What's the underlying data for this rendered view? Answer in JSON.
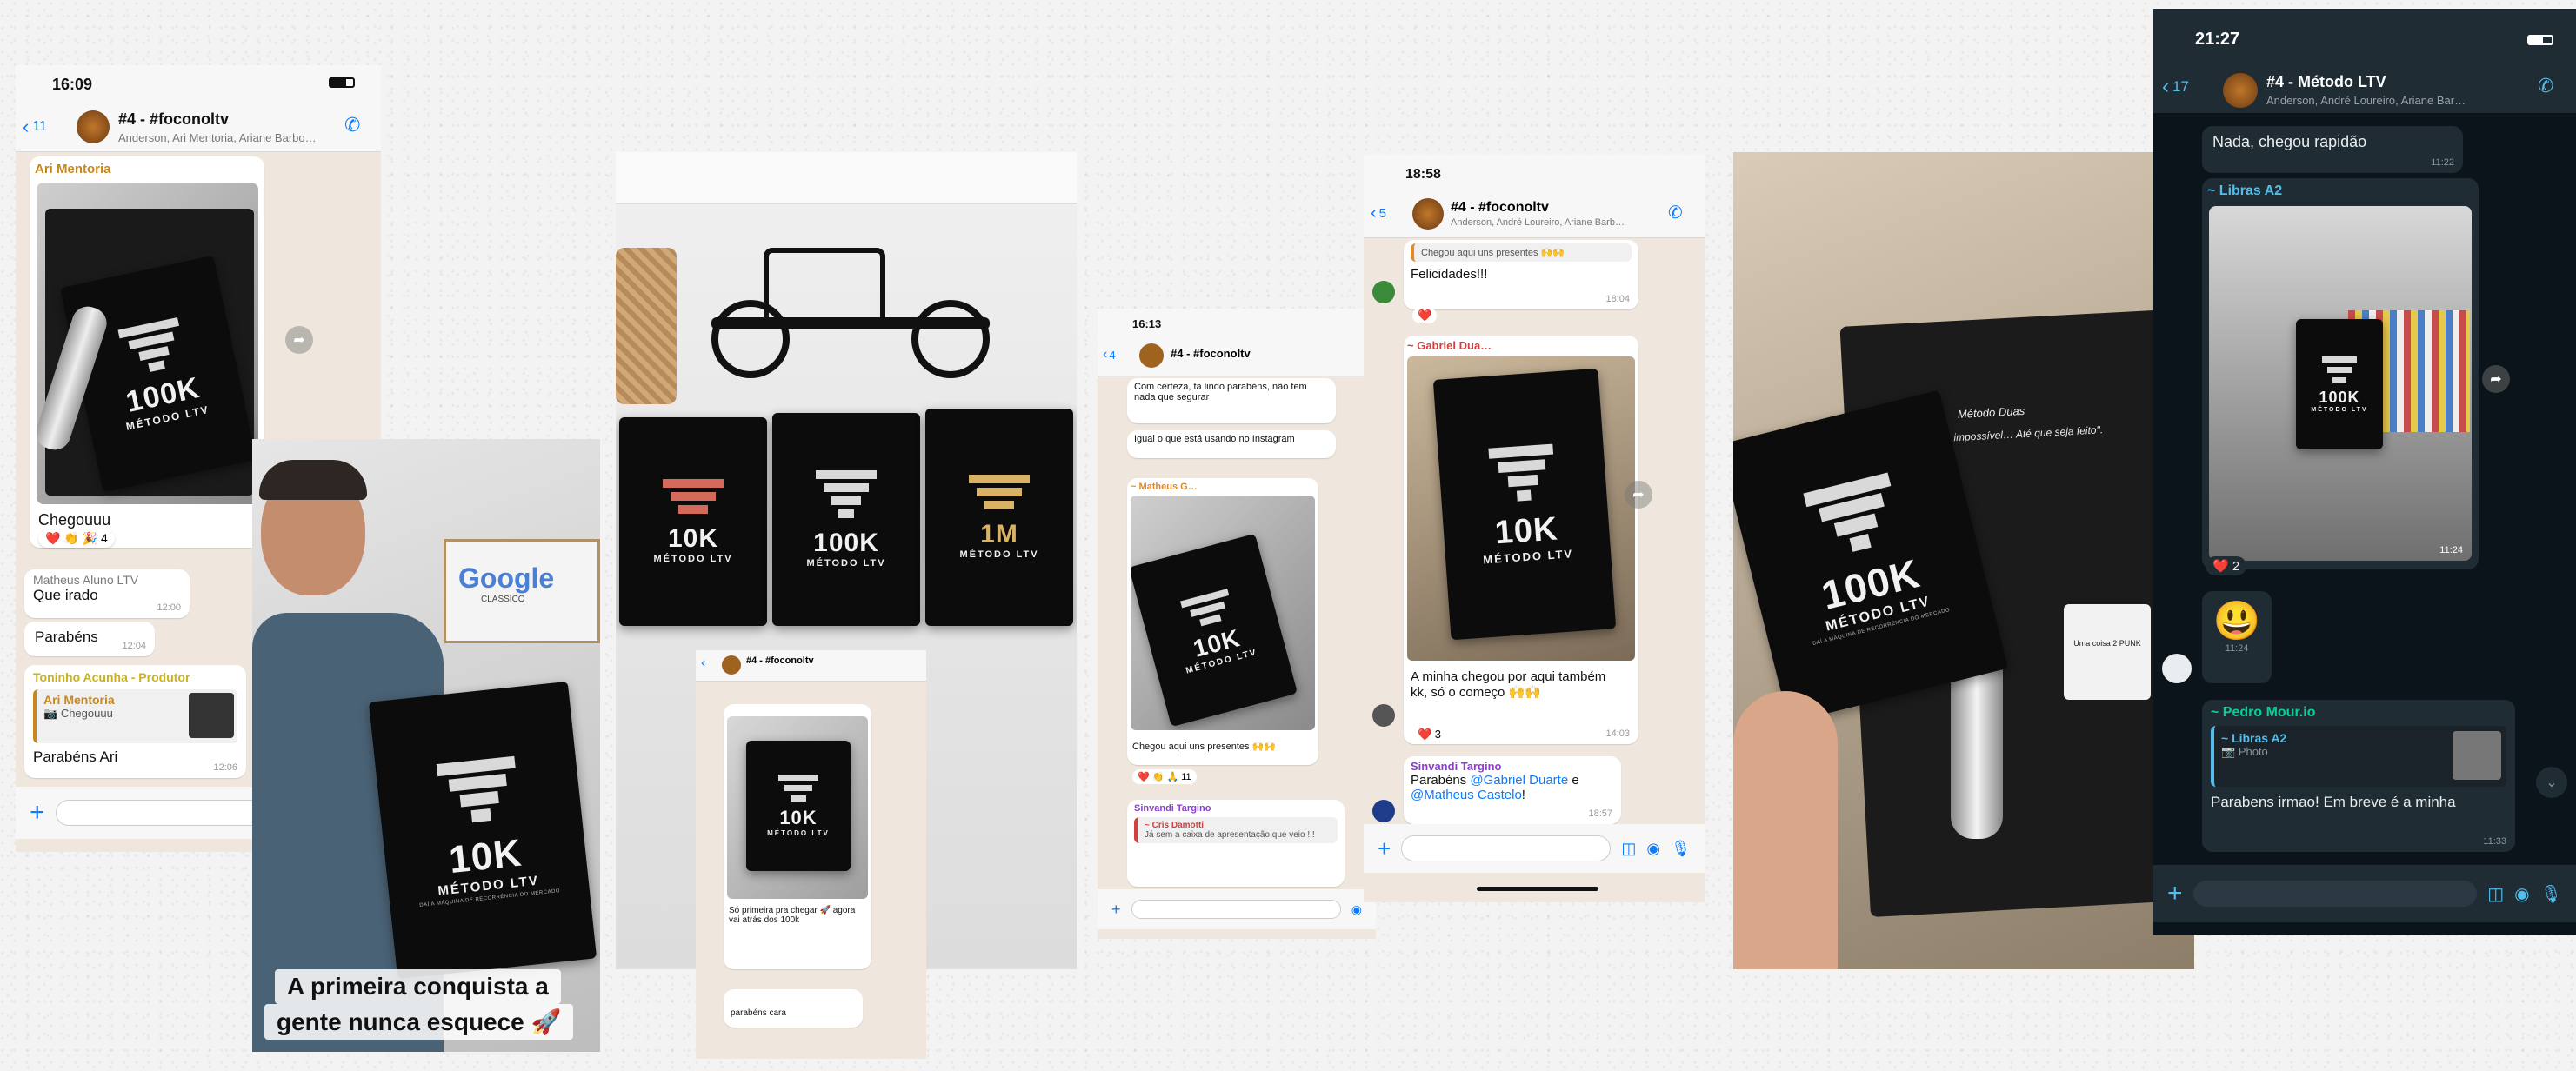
{
  "colors": {
    "wa_green": "#06cf9c",
    "ios_blue": "#0a7cff",
    "chat_bg_light": "#efe7dd",
    "chat_bg_dark": "#0b141a",
    "plaque_black": "#0c0c0c"
  },
  "p1": {
    "time": "16:09",
    "back_count": "11",
    "group": "#4 - #foconoltv",
    "members": "Anderson, Ari Mentoria, Ariane Barbo…",
    "msg1_sender": "Ari Mentoria",
    "msg1_text": "Chegouuu",
    "msg1_reactions": "❤️ 👏 🎉 4",
    "msg2_sender": "Matheus Aluno LTV",
    "msg2_text": "Que irado",
    "msg2_time": "12:00",
    "msg3_text": "Parabéns",
    "msg3_time": "12:04",
    "msg4_sender": "Toninho Acunha - Produtor",
    "msg4_quote_sender": "Ari Mentoria",
    "msg4_quote_text": "Chegouuu",
    "msg4_text": "Parabéns Ari",
    "msg4_time": "12:06"
  },
  "photo1": {
    "caption_line1": "A primeira conquista a",
    "caption_line2": "gente nunca esquece 🚀",
    "sign_text": "Google",
    "sign_sub": "CLASSICO"
  },
  "plaques": {
    "k10": "10K",
    "k100": "100K",
    "m1": "1M",
    "method": "MÉTODO LTV",
    "tag": "DAÍ A MÁQUINA DE RECORRÊNCIA DO MERCADO"
  },
  "p3": {
    "group": "#4 - #foconoltv",
    "msg1_text": "Só primeira pra chegar 🚀 agora vai atrás dos 100k",
    "msg2_text": "parabéns cara"
  },
  "p4": {
    "time": "16:13",
    "back_count": "4",
    "group": "#4 - #foconoltv",
    "msg1_text": "Com certeza, ta lindo parabéns, não tem nada que segurar",
    "msg2_text": "Igual o que está usando no Instagram",
    "msg3_sender": "~ Matheus G…",
    "msg3_text": "Chegou aqui uns presentes 🙌🙌",
    "msg3_reactions": "❤️ 👏 🙏 11",
    "msg4_sender": "Sinvandi Targino",
    "msg4_quote": "~ Cris Damotti",
    "msg4_quote_text": "Já sem a caixa de apresentação que veio !!!"
  },
  "p5": {
    "time": "18:58",
    "back_count": "5",
    "group": "#4 - #foconoltv",
    "members": "Anderson, André Loureiro, Ariane Barb…",
    "msg0_quote": "Chegou aqui uns presentes 🙌🙌",
    "msg1_text": "Felicidades!!!",
    "msg1_time": "18:04",
    "msg2_sender": "~ Gabriel Dua…",
    "msg2_text": "A minha chegou por aqui também kk, só o começo 🙌🙌",
    "msg2_time": "14:03",
    "msg3_sender": "Sinvandi Targino",
    "msg3_text_a": "Parabéns ",
    "msg3_mention1": "@Gabriel Duarte",
    "msg3_text_b": " e ",
    "msg3_mention2": "@Matheus Castelo",
    "msg3_text_c": "!",
    "msg3_time": "18:57"
  },
  "photo2": {
    "box_text_1": "Método Duas",
    "box_text_2": "\"Tudo parece impossível… Até que seja feito\".",
    "mug_text": "Uma coisa 2 PUNK"
  },
  "p7": {
    "time": "21:27",
    "back_count": "17",
    "group": "#4 - Método LTV",
    "members": "Anderson, André Loureiro, Ariane Bar…",
    "msg1_text": "Nada, chegou rapidão",
    "msg1_time": "11:22",
    "msg2_sender": "~ Libras A2",
    "msg2_time": "11:24",
    "msg2_reactions": "❤️ 2",
    "msg3_time": "11:24",
    "msg4_sender": "~ Pedro Mour.io",
    "msg4_quote_sender": "~ Libras A2",
    "msg4_quote_text": "Photo",
    "msg4_text": "Parabens irmao! Em breve é a minha",
    "msg4_time": "11:33"
  }
}
